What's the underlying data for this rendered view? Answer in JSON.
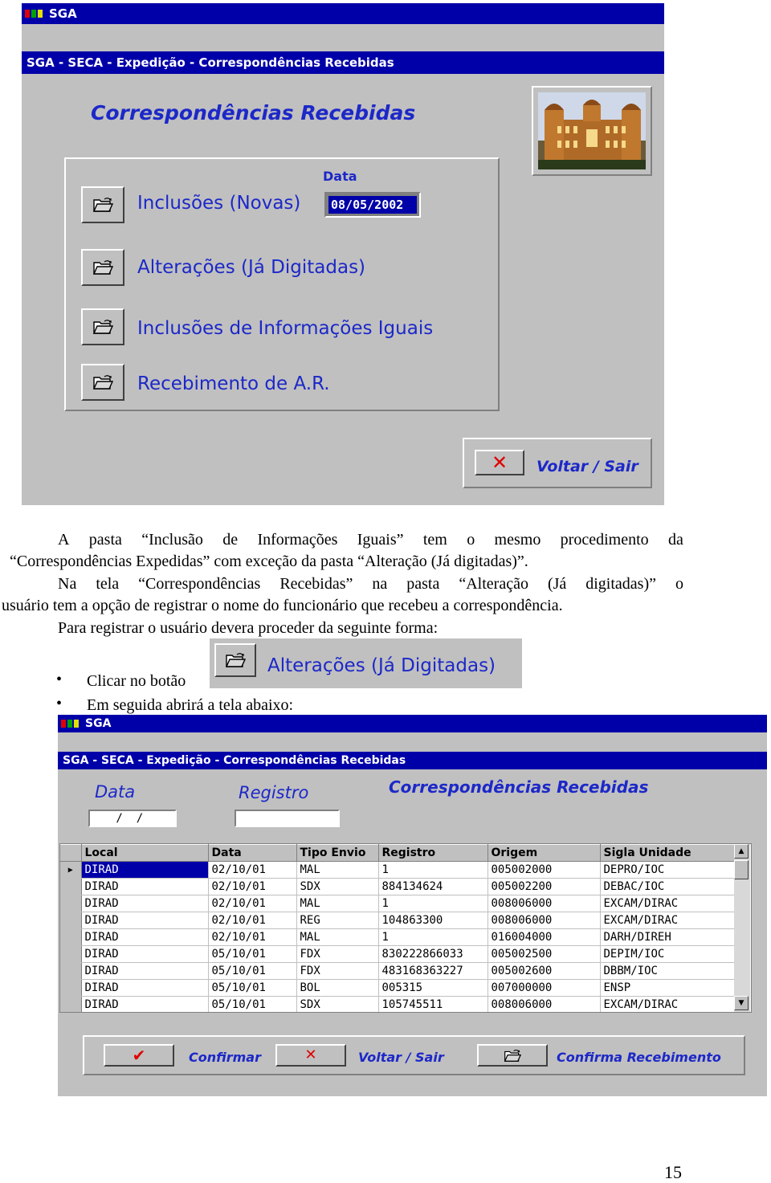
{
  "screen1": {
    "app_title": "SGA",
    "window_caption": "SGA - SECA - Expedição - Correspondências Recebidas",
    "heading": "Correspondências Recebidas",
    "date_label": "Data",
    "date_value": "08/05/2002",
    "options": [
      {
        "label": "Inclusões (Novas)"
      },
      {
        "label": "Alterações (Já Digitadas)"
      },
      {
        "label": "Inclusões de Informações Iguais"
      },
      {
        "label": "Recebimento de A.R."
      }
    ],
    "exit_label": "Voltar / Sair"
  },
  "body_text": {
    "p1_line1": [
      "A",
      "pasta",
      "“Inclusão",
      "de",
      "Informações",
      "Iguais”",
      "tem",
      "o",
      "mesmo",
      "procedimento",
      "da"
    ],
    "p1_line2": "“Correspondências Expedidas” com exceção da pasta “Alteração (Já digitadas)”.",
    "p2_line1": [
      "Na",
      "tela",
      "“Correspondências",
      "Recebidas”",
      "na",
      "pasta",
      "“Alteração",
      "(Já",
      "digitadas)”",
      "o"
    ],
    "p2_line2": "usuário tem a opção de registrar o nome do funcionário que recebeu a correspondência.",
    "p3": "Para registrar o usuário devera proceder da seguinte forma:",
    "bullet1": "Clicar no botão",
    "bullet2": "Em seguida abrirá a tela abaixo:",
    "inline_button_label": "Alterações (Já Digitadas)"
  },
  "screen2": {
    "app_title": "SGA",
    "window_caption": "SGA - SECA - Expedição -  Correspondências Recebidas",
    "heading": "Correspondências Recebidas",
    "date_label": "Data",
    "date_value": " /  /",
    "registro_label": "Registro",
    "registro_value": "",
    "columns": [
      "Local",
      "Data",
      "Tipo Envio",
      "Registro",
      "Origem",
      "Sigla Unidade"
    ],
    "rows": [
      [
        "DIRAD",
        "02/10/01",
        "MAL",
        "1",
        "005002000",
        "DEPRO/IOC"
      ],
      [
        "DIRAD",
        "02/10/01",
        "SDX",
        "884134624",
        "005002200",
        "DEBAC/IOC"
      ],
      [
        "DIRAD",
        "02/10/01",
        "MAL",
        "1",
        "008006000",
        "EXCAM/DIRAC"
      ],
      [
        "DIRAD",
        "02/10/01",
        "REG",
        "104863300",
        "008006000",
        "EXCAM/DIRAC"
      ],
      [
        "DIRAD",
        "02/10/01",
        "MAL",
        "1",
        "016004000",
        "DARH/DIREH"
      ],
      [
        "DIRAD",
        "05/10/01",
        "FDX",
        "830222866033",
        "005002500",
        "DEPIM/IOC"
      ],
      [
        "DIRAD",
        "05/10/01",
        "FDX",
        "483168363227",
        "005002600",
        "DBBM/IOC"
      ],
      [
        "DIRAD",
        "05/10/01",
        "BOL",
        "005315",
        "007000000",
        "ENSP"
      ],
      [
        "DIRAD",
        "05/10/01",
        "SDX",
        "105745511",
        "008006000",
        "EXCAM/DIRAC"
      ]
    ],
    "confirm_label": "Confirmar",
    "exit_label": "Voltar / Sair",
    "confirm_receipt_label": "Confirma Recebimento"
  },
  "page_number": "15",
  "colors": {
    "titlebar": "#0000a8",
    "window_bg": "#c0c0c0",
    "accent_text": "#1c28c8",
    "icon_red": "#e00000"
  }
}
